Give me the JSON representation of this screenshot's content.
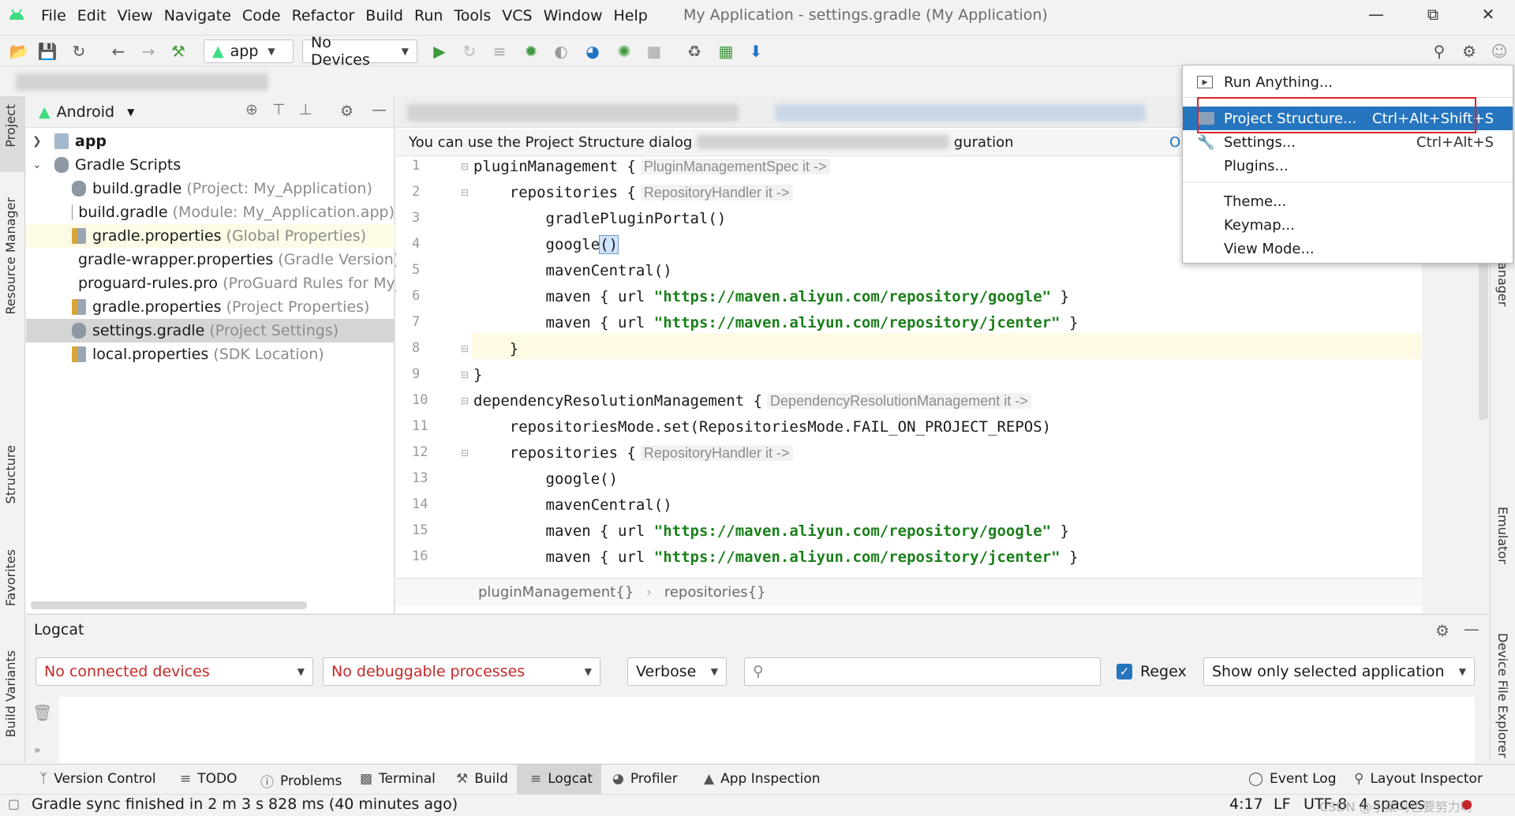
{
  "menubar": {
    "items": [
      "File",
      "Edit",
      "View",
      "Navigate",
      "Code",
      "Refactor",
      "Build",
      "Run",
      "Tools",
      "VCS",
      "Window",
      "Help"
    ],
    "title": "My Application - settings.gradle (My Application)"
  },
  "toolbar": {
    "run_config": "app",
    "device": "No Devices"
  },
  "project": {
    "view_mode": "Android",
    "tree": [
      {
        "label": "app",
        "hint": ""
      },
      {
        "label": "Gradle Scripts",
        "hint": ""
      },
      {
        "label": "build.gradle",
        "hint": "(Project: My_Application)"
      },
      {
        "label": "build.gradle",
        "hint": "(Module: My_Application.app)"
      },
      {
        "label": "gradle.properties",
        "hint": "(Global Properties)"
      },
      {
        "label": "gradle-wrapper.properties",
        "hint": "(Gradle Version)"
      },
      {
        "label": "proguard-rules.pro",
        "hint": "(ProGuard Rules for My_"
      },
      {
        "label": "gradle.properties",
        "hint": "(Project Properties)"
      },
      {
        "label": "settings.gradle",
        "hint": "(Project Settings)"
      },
      {
        "label": "local.properties",
        "hint": "(SDK Location)"
      }
    ]
  },
  "editor": {
    "notice_start": "You can use the Project Structure dialog",
    "notice_end": "guration",
    "notice_link": "O",
    "lines": {
      "l1": "pluginManagement {",
      "l1_hint": "PluginManagementSpec it ->",
      "l2": "    repositories {",
      "l2_hint": "RepositoryHandler it ->",
      "l3": "        gradlePluginPortal()",
      "l4a": "        google",
      "l4b": "()",
      "l5": "        mavenCentral()",
      "l6a": "        maven { url ",
      "l6s": "\"https://maven.aliyun.com/repository/google\"",
      "l6b": " }",
      "l7a": "        maven { url ",
      "l7s": "\"https://maven.aliyun.com/repository/jcenter\"",
      "l7b": " }",
      "l8": "    }",
      "l9": "}",
      "l10": "dependencyResolutionManagement {",
      "l10_hint": "DependencyResolutionManagement it ->",
      "l11": "    repositoriesMode.set(RepositoriesMode.FAIL_ON_PROJECT_REPOS)",
      "l12": "    repositories {",
      "l12_hint": "RepositoryHandler it ->",
      "l13": "        google()",
      "l14": "        mavenCentral()",
      "l15a": "        maven { url ",
      "l15s": "\"https://maven.aliyun.com/repository/google\"",
      "l15b": " }",
      "l16a": "        maven { url ",
      "l16s": "\"https://maven.aliyun.com/repository/jcenter\"",
      "l16b": " }"
    },
    "line_numbers": [
      "1",
      "2",
      "3",
      "4",
      "5",
      "6",
      "7",
      "8",
      "9",
      "10",
      "11",
      "12",
      "13",
      "14",
      "15",
      "16"
    ],
    "breadcrumb_1": "pluginManagement{}",
    "breadcrumb_2": "repositories{}"
  },
  "dropdown": {
    "run_anything": "Run Anything...",
    "project_structure": "Project Structure...",
    "project_structure_shortcut": "Ctrl+Alt+Shift+S",
    "settings": "Settings...",
    "settings_shortcut": "Ctrl+Alt+S",
    "plugins": "Plugins...",
    "theme": "Theme...",
    "keymap": "Keymap...",
    "view_mode": "View Mode..."
  },
  "right_strip": {
    "manager": "anager",
    "emulator": "Emulator",
    "device_file_explorer": "Device File Explorer"
  },
  "left_strip": {
    "project": "Project",
    "resource_manager": "Resource Manager",
    "structure": "Structure",
    "favorites": "Favorites",
    "build_variants": "Build Variants"
  },
  "logcat": {
    "title": "Logcat",
    "devices": "No connected devices",
    "processes": "No debuggable processes",
    "level": "Verbose",
    "search_placeholder": "",
    "regex_label": "Regex",
    "filter": "Show only selected application"
  },
  "bottom_tabs": [
    "Version Control",
    "TODO",
    "Problems",
    "Terminal",
    "Build",
    "Logcat",
    "Profiler",
    "App Inspection"
  ],
  "bottom_right_tabs": [
    "Event Log",
    "Layout Inspector"
  ],
  "status": {
    "message": "Gradle sync finished in 2 m 3 s 828 ms (40 minutes ago)",
    "position": "4:17",
    "line_sep": "LF",
    "encoding": "UTF-8",
    "indent": "4 spaces",
    "watermark": "CSDN @小菜鸟也要努力呀"
  },
  "colors": {
    "selection": "#2675bf",
    "highlight_box": "#e0232a",
    "string": "#1a7f1a",
    "error_text": "#c62828",
    "android_green": "#3ddc84"
  }
}
